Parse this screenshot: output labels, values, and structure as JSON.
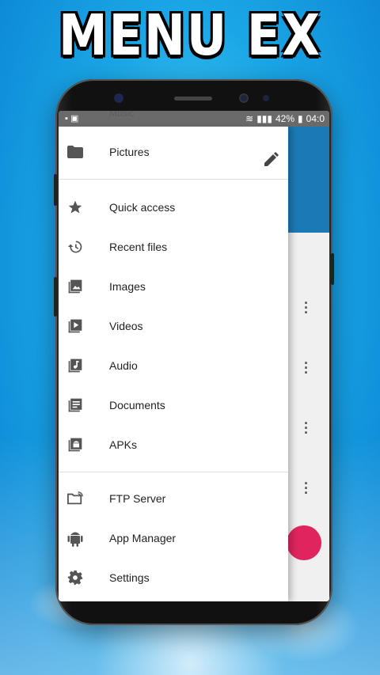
{
  "promo": {
    "title": "MENU EX"
  },
  "status_bar": {
    "faded_label": "Music",
    "battery": "42%",
    "time": "04:0"
  },
  "drawer": {
    "header_item": "Pictures",
    "section1": [
      "Quick access",
      "Recent files",
      "Images",
      "Videos",
      "Audio",
      "Documents",
      "APKs"
    ],
    "section2": [
      "FTP Server",
      "App Manager",
      "Settings"
    ]
  },
  "colors": {
    "accent_header": "#1b7ab5",
    "fab": "#e0245e",
    "icon": "#555555"
  }
}
